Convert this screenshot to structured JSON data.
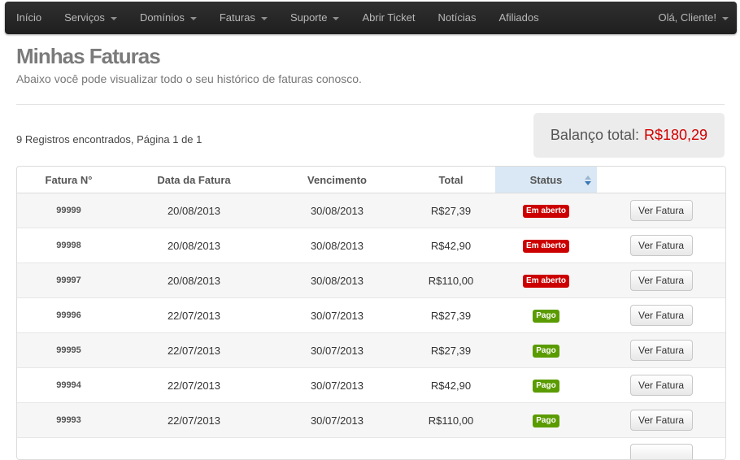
{
  "nav": {
    "items": [
      {
        "label": "Início",
        "caret": false
      },
      {
        "label": "Serviços",
        "caret": true
      },
      {
        "label": "Domínios",
        "caret": true
      },
      {
        "label": "Faturas",
        "caret": true
      },
      {
        "label": "Suporte",
        "caret": true
      },
      {
        "label": "Abrir Ticket",
        "caret": false
      },
      {
        "label": "Notícias",
        "caret": false
      },
      {
        "label": "Afiliados",
        "caret": false
      }
    ],
    "user_label": "Olá, Cliente!"
  },
  "header": {
    "title": "Minhas Faturas",
    "subtitle": "Abaixo você pode visualizar todo o seu histórico de faturas conosco."
  },
  "records_text": "9 Registros encontrados, Página 1 de 1",
  "balance": {
    "label": "Balanço total:",
    "amount": "R$180,29"
  },
  "table": {
    "columns": [
      "Fatura N°",
      "Data da Fatura",
      "Vencimento",
      "Total",
      "Status",
      ""
    ],
    "rows": [
      {
        "number": "99999",
        "date": "20/08/2013",
        "due": "30/08/2013",
        "total": "R$27,39",
        "status": "Em aberto",
        "status_type": "unpaid",
        "action": "Ver Fatura"
      },
      {
        "number": "99998",
        "date": "20/08/2013",
        "due": "30/08/2013",
        "total": "R$42,90",
        "status": "Em aberto",
        "status_type": "unpaid",
        "action": "Ver Fatura"
      },
      {
        "number": "99997",
        "date": "20/08/2013",
        "due": "30/08/2013",
        "total": "R$110,00",
        "status": "Em aberto",
        "status_type": "unpaid",
        "action": "Ver Fatura"
      },
      {
        "number": "99996",
        "date": "22/07/2013",
        "due": "30/07/2013",
        "total": "R$27,39",
        "status": "Pago",
        "status_type": "paid",
        "action": "Ver Fatura"
      },
      {
        "number": "99995",
        "date": "22/07/2013",
        "due": "30/07/2013",
        "total": "R$27,39",
        "status": "Pago",
        "status_type": "paid",
        "action": "Ver Fatura"
      },
      {
        "number": "99994",
        "date": "22/07/2013",
        "due": "30/07/2013",
        "total": "R$42,90",
        "status": "Pago",
        "status_type": "paid",
        "action": "Ver Fatura"
      },
      {
        "number": "99993",
        "date": "22/07/2013",
        "due": "30/07/2013",
        "total": "R$110,00",
        "status": "Pago",
        "status_type": "paid",
        "action": "Ver Fatura"
      },
      {
        "number": "",
        "date": "",
        "due": "",
        "total": "",
        "status": "",
        "status_type": "paid",
        "action": ""
      }
    ]
  },
  "colors": {
    "unpaid": "#cc0000",
    "paid": "#5a9b00",
    "balance_amount": "#d10000",
    "sorted_header": "#d9e8f4"
  },
  "icons": {
    "sort": "sort-arrows-icon",
    "caret": "caret-down-icon"
  }
}
